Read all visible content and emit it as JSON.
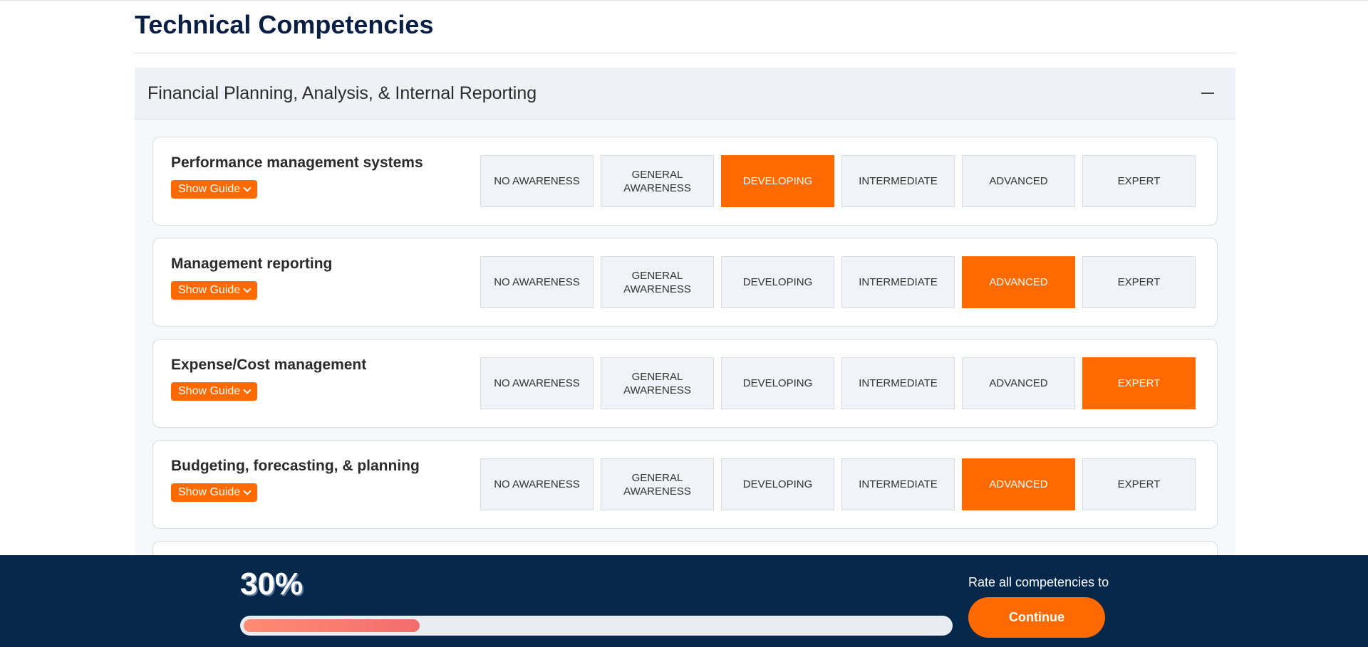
{
  "page": {
    "title": "Technical Competencies"
  },
  "section": {
    "title": "Financial Planning, Analysis, & Internal Reporting",
    "toggle_icon": "minus-icon"
  },
  "guide_label": "Show Guide",
  "levels": [
    "NO AWARENESS",
    "GENERAL AWARENESS",
    "DEVELOPING",
    "INTERMEDIATE",
    "ADVANCED",
    "EXPERT"
  ],
  "competencies": [
    {
      "title": "Performance management systems",
      "selected": "DEVELOPING"
    },
    {
      "title": "Management reporting",
      "selected": "ADVANCED"
    },
    {
      "title": "Expense/Cost management",
      "selected": "EXPERT"
    },
    {
      "title": "Budgeting, forecasting, & planning",
      "selected": "ADVANCED"
    }
  ],
  "footer": {
    "percent_label": "30%",
    "progress": 0.3,
    "note": "Rate all competencies to",
    "continue_label": "Continue"
  },
  "colors": {
    "accent": "#ff6a00",
    "footer_bg": "#04274a",
    "title": "#0b1f44"
  }
}
